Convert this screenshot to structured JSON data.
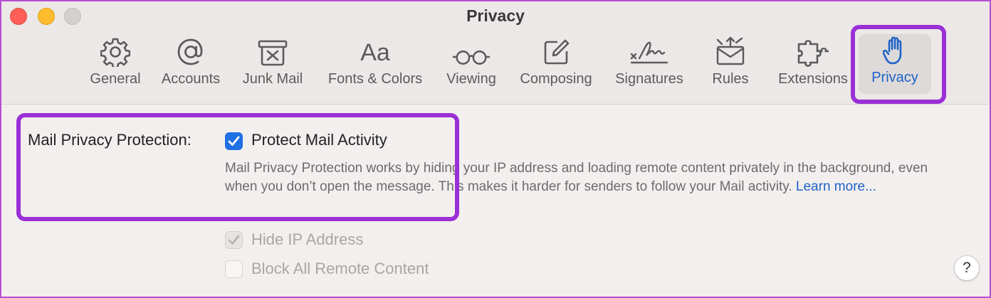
{
  "window": {
    "title": "Privacy"
  },
  "toolbar": {
    "tabs": [
      {
        "label": "General",
        "icon": "gear-icon"
      },
      {
        "label": "Accounts",
        "icon": "at-sign-icon"
      },
      {
        "label": "Junk Mail",
        "icon": "junk-bin-icon"
      },
      {
        "label": "Fonts & Colors",
        "icon": "font-aa-icon",
        "glyph": "Aa"
      },
      {
        "label": "Viewing",
        "icon": "glasses-icon"
      },
      {
        "label": "Composing",
        "icon": "compose-icon"
      },
      {
        "label": "Signatures",
        "icon": "signature-icon"
      },
      {
        "label": "Rules",
        "icon": "rules-envelope-icon"
      },
      {
        "label": "Extensions",
        "icon": "puzzle-piece-icon"
      },
      {
        "label": "Privacy",
        "icon": "hand-raised-icon",
        "selected": true
      }
    ]
  },
  "privacy": {
    "section_label": "Mail Privacy Protection:",
    "protect_mail_activity": {
      "label": "Protect Mail Activity",
      "checked": true
    },
    "description": "Mail Privacy Protection works by hiding your IP address and loading remote content privately in the background, even when you don’t open the message. This makes it harder for senders to follow your Mail activity.",
    "learn_more": "Learn more...",
    "hide_ip": {
      "label": "Hide IP Address",
      "checked": true,
      "disabled": true
    },
    "block_remote": {
      "label": "Block All Remote Content",
      "checked": false,
      "disabled": true
    }
  },
  "help": {
    "glyph": "?"
  },
  "colors": {
    "accent": "#1f6fe5",
    "highlight": "#9a2fd6",
    "selected_tab_text": "#1f63c7"
  }
}
